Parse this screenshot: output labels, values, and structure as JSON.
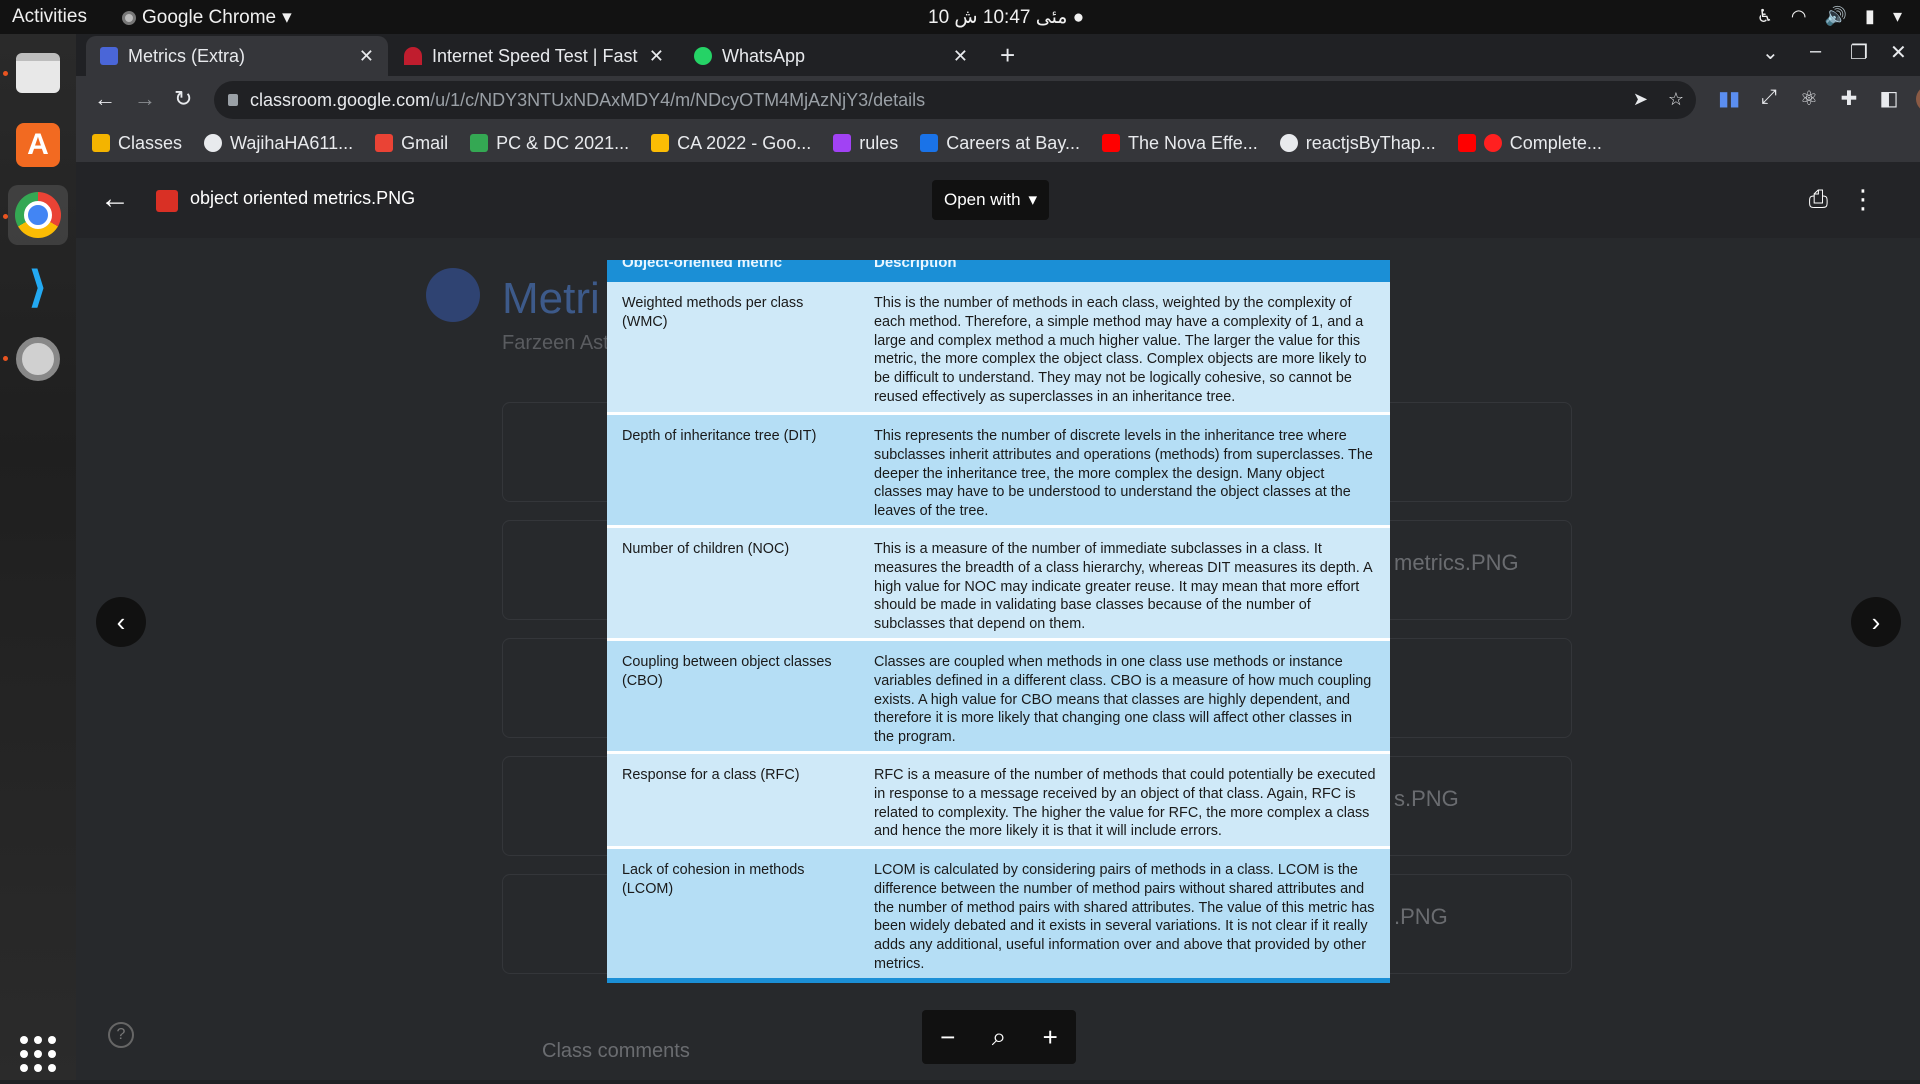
{
  "system": {
    "activities": "Activities",
    "app_name": "Google Chrome",
    "clock": "10 مئى 10:47 ش"
  },
  "browser": {
    "tabs": [
      {
        "title": "Metrics (Extra)",
        "active": true,
        "icon_color": "#4a66d8"
      },
      {
        "title": "Internet Speed Test | Fast",
        "active": false,
        "icon_color": "#c01d2e"
      },
      {
        "title": "WhatsApp",
        "active": false,
        "icon_color": "#25d366"
      }
    ],
    "url_host": "classroom.google.com",
    "url_path": "/u/1/c/NDY3NTUxNDAxMDY4/m/NDcyOTM4MjAzNjY3/details",
    "bookmarks": [
      {
        "label": "Classes",
        "color": "#f4b400"
      },
      {
        "label": "WajihaHA611...",
        "color": "#e8eaed"
      },
      {
        "label": "Gmail",
        "color": "#ea4335"
      },
      {
        "label": "PC & DC 2021...",
        "color": "#34a853"
      },
      {
        "label": "CA 2022 - Goo...",
        "color": "#fbbc04"
      },
      {
        "label": "rules",
        "color": "#a142f4"
      },
      {
        "label": "Careers at Bay...",
        "color": "#1a73e8"
      },
      {
        "label": "The Nova Effe...",
        "color": "#ff0000"
      },
      {
        "label": "reactjsByThap...",
        "color": "#e8eaed"
      },
      {
        "label": "Complete...",
        "color": "#ff0000"
      }
    ]
  },
  "background_page": {
    "title": "Metri",
    "subtitle": "Farzeen Ast",
    "files": [
      "metrics.PNG",
      "s.PNG",
      ".PNG"
    ],
    "class_comments": "Class comments"
  },
  "viewer": {
    "file_name": "object oriented metrics.PNG",
    "open_with": "Open with"
  },
  "table": {
    "header_metric": "Object-oriented metric",
    "header_description": "Description",
    "rows": [
      {
        "metric": "Weighted methods per class (WMC)",
        "description": "This is the number of methods in each class, weighted by the complexity of each method. Therefore, a simple method may have a complexity of 1, and a large and complex method a much higher value. The larger the value for this metric, the more complex the object class. Complex objects are more likely to be difficult to understand. They may not be logically cohesive, so cannot be reused effectively as superclasses in an inheritance tree."
      },
      {
        "metric": "Depth of inheritance tree (DIT)",
        "description": "This represents the number of discrete levels in the inheritance tree where subclasses inherit attributes and operations (methods) from superclasses. The deeper the inheritance tree, the more complex the design. Many object classes may have to be understood to understand the object classes at the leaves of the tree."
      },
      {
        "metric": "Number of children (NOC)",
        "description": "This is a measure of the number of immediate subclasses in a class. It measures the breadth of a class hierarchy, whereas DIT measures its depth. A high value for NOC may indicate greater reuse. It may mean that more effort should be made in validating base classes because of the number of subclasses that depend on them."
      },
      {
        "metric": "Coupling between object classes (CBO)",
        "description": "Classes are coupled when methods in one class use methods or instance variables defined in a different class. CBO is a measure of how much coupling exists. A high value for CBO means that classes are highly dependent, and therefore it is more likely that changing one class will affect other classes in the program."
      },
      {
        "metric": "Response for a class (RFC)",
        "description": "RFC is a measure of the number of methods that could potentially be executed in response to a message received by an object of that class. Again, RFC is related to complexity. The higher the value for RFC, the more complex a class and hence the more likely it is that it will include errors."
      },
      {
        "metric": "Lack of cohesion in methods (LCOM)",
        "description": "LCOM is calculated by considering pairs of methods in a class. LCOM is the difference between the number of method pairs without shared attributes and the number of method pairs with shared attributes. The value of this metric has been widely debated and it exists in several variations. It is not clear if it really adds any additional, useful information over and above that provided by other metrics."
      }
    ]
  }
}
